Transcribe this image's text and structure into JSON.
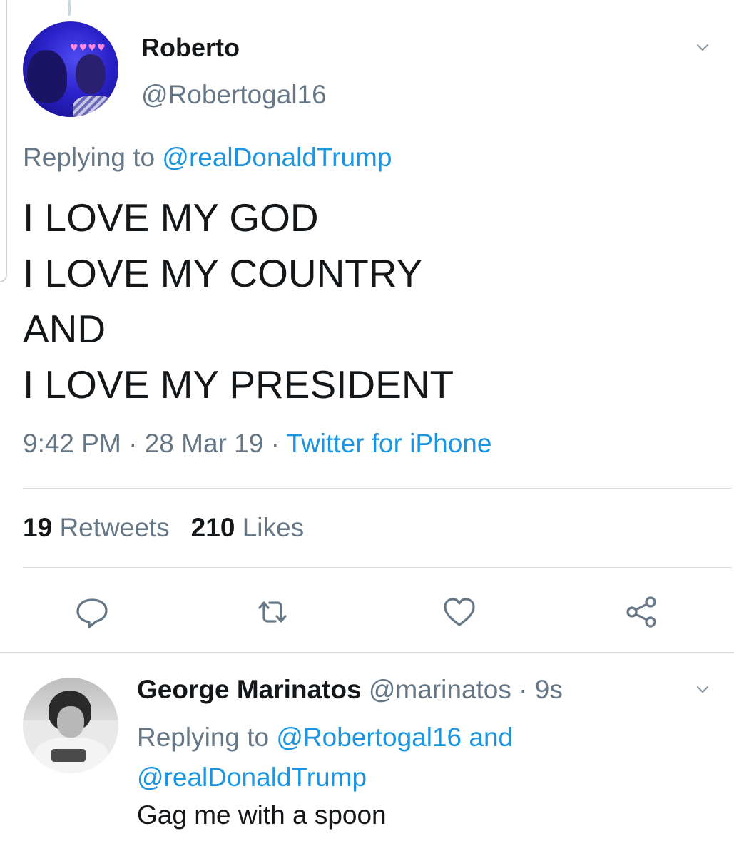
{
  "tweet": {
    "author_name": "Roberto",
    "author_handle": "@Robertogal16",
    "replying_prefix": "Replying to",
    "replying_to": "@realDonaldTrump",
    "text_lines": [
      "I LOVE MY GOD",
      "I LOVE MY COUNTRY",
      "AND",
      "I LOVE MY PRESIDENT"
    ],
    "time": "9:42 PM",
    "separator": "·",
    "date": "28 Mar 19",
    "source": "Twitter for iPhone",
    "retweets_count": "19",
    "retweets_label": "Retweets",
    "likes_count": "210",
    "likes_label": "Likes"
  },
  "actions": {
    "reply_icon": "reply-icon",
    "retweet_icon": "retweet-icon",
    "like_icon": "heart-icon",
    "share_icon": "share-icon"
  },
  "reply": {
    "author_name": "George Marinatos",
    "author_handle": "@marinatos",
    "separator": "·",
    "age": "9s",
    "replying_prefix": "Replying to",
    "replying_to_1": "@Robertogal16",
    "conjunction": "and",
    "replying_to_2": "@realDonaldTrump",
    "text": "Gag me with a spoon"
  },
  "colors": {
    "link": "#1b95e0",
    "secondary_text": "#657786",
    "primary_text": "#14171a",
    "divider": "#d9dee2"
  }
}
